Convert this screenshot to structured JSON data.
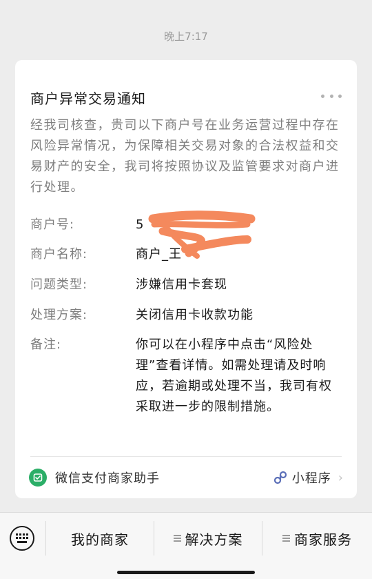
{
  "timestamp": "晚上7:17",
  "card": {
    "title": "商户异常交易通知",
    "description": "经我司核查，贵司以下商户号在业务运营过程中存在风险异常情况，为保障相关交易对象的合法权益和交易财产的安全，我司将按照协议及监管要求对商户进行处理。",
    "fields": [
      {
        "label": "商户号:",
        "value": "5"
      },
      {
        "label": "商户名称:",
        "value": "商户_王"
      },
      {
        "label": "问题类型:",
        "value": "涉嫌信用卡套现"
      },
      {
        "label": "处理方案:",
        "value": "关闭信用卡收款功能"
      },
      {
        "label": "备注:",
        "value": "你可以在小程序中点击“风险处理”查看详情。如需处理请及时响应，若逾期或处理不当，我司有权采取进一步的限制措施。"
      }
    ],
    "footer": {
      "source_name": "微信支付商家助手",
      "source_icon": "wechat-pay-icon",
      "miniprogram_label": "小程序",
      "miniprogram_icon": "mini-program-link-icon"
    }
  },
  "bottom_menu": {
    "keyboard_icon": "keyboard-icon",
    "items": [
      {
        "label": "我的商家"
      },
      {
        "label": "解决方案"
      },
      {
        "label": "商家服务"
      }
    ]
  },
  "colors": {
    "brand_green": "#2bae67",
    "redaction": "#f4895d",
    "miniprogram_blue": "#5b6fb8"
  }
}
